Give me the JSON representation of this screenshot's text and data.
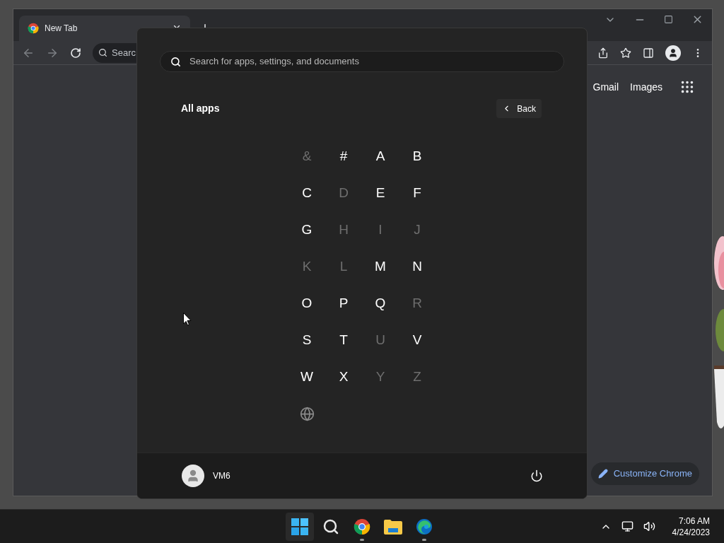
{
  "browser": {
    "tab": {
      "title": "New Tab"
    },
    "omnibox": {
      "placeholder": "Searc"
    },
    "ntp_links": [
      "Gmail",
      "Images"
    ],
    "customize_button": "Customize Chrome"
  },
  "start_menu": {
    "search": {
      "placeholder": "Search for apps, settings, and documents"
    },
    "heading": "All apps",
    "back_button": "Back",
    "letters": [
      {
        "label": "&",
        "disabled": true
      },
      {
        "label": "#",
        "disabled": false
      },
      {
        "label": "A",
        "disabled": false
      },
      {
        "label": "B",
        "disabled": false
      },
      {
        "label": "C",
        "disabled": false
      },
      {
        "label": "D",
        "disabled": true
      },
      {
        "label": "E",
        "disabled": false
      },
      {
        "label": "F",
        "disabled": false
      },
      {
        "label": "G",
        "disabled": false
      },
      {
        "label": "H",
        "disabled": true
      },
      {
        "label": "I",
        "disabled": true
      },
      {
        "label": "J",
        "disabled": true
      },
      {
        "label": "K",
        "disabled": true
      },
      {
        "label": "L",
        "disabled": true
      },
      {
        "label": "M",
        "disabled": false
      },
      {
        "label": "N",
        "disabled": false
      },
      {
        "label": "O",
        "disabled": false
      },
      {
        "label": "P",
        "disabled": false
      },
      {
        "label": "Q",
        "disabled": false
      },
      {
        "label": "R",
        "disabled": true
      },
      {
        "label": "S",
        "disabled": false
      },
      {
        "label": "T",
        "disabled": false
      },
      {
        "label": "U",
        "disabled": true
      },
      {
        "label": "V",
        "disabled": false
      },
      {
        "label": "W",
        "disabled": false
      },
      {
        "label": "X",
        "disabled": false
      },
      {
        "label": "Y",
        "disabled": true
      },
      {
        "label": "Z",
        "disabled": true
      }
    ],
    "user": {
      "name": "VM6"
    }
  },
  "taskbar": {
    "apps": [
      {
        "kind": "start",
        "running": false
      },
      {
        "kind": "search",
        "running": false
      },
      {
        "kind": "chrome",
        "running": true
      },
      {
        "kind": "explorer",
        "running": false
      },
      {
        "kind": "edge",
        "running": true
      }
    ],
    "clock": {
      "time": "7:06 AM",
      "date": "4/24/2023"
    }
  }
}
